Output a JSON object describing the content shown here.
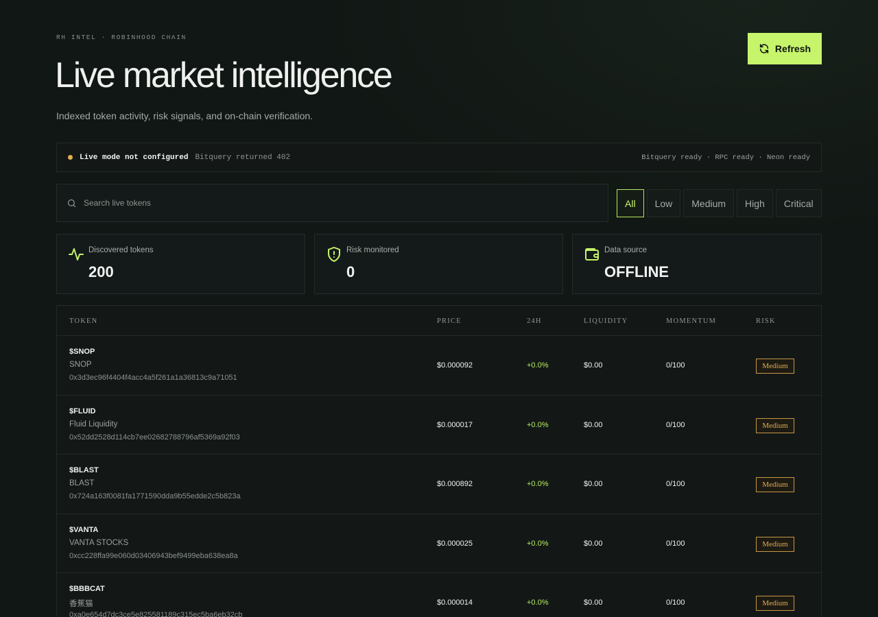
{
  "header": {
    "eyebrow": "RH INTEL · ROBINHOOD CHAIN",
    "title": "Live market intelligence",
    "subtitle": "Indexed token activity, risk signals, and on-chain verification.",
    "refresh_label": "Refresh",
    "refresh_icon": "refresh-icon"
  },
  "status": {
    "title": "Live mode not configured",
    "detail": "Bitquery returned 402",
    "services": "Bitquery ready · RPC ready · Neon ready",
    "dot_color": "#e1b14c"
  },
  "search": {
    "placeholder": "Search live tokens",
    "value": ""
  },
  "filters": [
    "All",
    "Low",
    "Medium",
    "High",
    "Critical"
  ],
  "active_filter": "All",
  "stats": [
    {
      "label": "Discovered tokens",
      "value": "200",
      "icon": "activity-icon"
    },
    {
      "label": "Risk monitored",
      "value": "0",
      "icon": "shield-alert-icon"
    },
    {
      "label": "Data source",
      "value": "OFFLINE",
      "icon": "wallet-icon"
    }
  ],
  "table": {
    "columns": [
      "TOKEN",
      "PRICE",
      "24H",
      "LIQUIDITY",
      "MOMENTUM",
      "RISK"
    ],
    "rows": [
      {
        "symbol": "$SNOP",
        "name": "SNOP",
        "address": "0x3d3ec96f4404f4acc4a5f261a1a36813c9a71051",
        "price": "$0.000092",
        "change": "+0.0%",
        "liquidity": "$0.00",
        "momentum": "0/100",
        "risk": "Medium"
      },
      {
        "symbol": "$FLUID",
        "name": "Fluid Liquidity",
        "address": "0x52dd2528d114cb7ee02682788796af5369a92f03",
        "price": "$0.000017",
        "change": "+0.0%",
        "liquidity": "$0.00",
        "momentum": "0/100",
        "risk": "Medium"
      },
      {
        "symbol": "$BLAST",
        "name": "BLAST",
        "address": "0x724a163f0081fa1771590dda9b55edde2c5b823a",
        "price": "$0.000892",
        "change": "+0.0%",
        "liquidity": "$0.00",
        "momentum": "0/100",
        "risk": "Medium"
      },
      {
        "symbol": "$VANTA",
        "name": "VANTA STOCKS",
        "address": "0xcc228ffa99e060d03406943bef9499eba638ea8a",
        "price": "$0.000025",
        "change": "+0.0%",
        "liquidity": "$0.00",
        "momentum": "0/100",
        "risk": "Medium"
      },
      {
        "symbol": "$BBBCAT",
        "name": "香蕉猫",
        "address": "0xa0e654d7dc3ce5e825581189c315ec5ba6eb32cb",
        "price": "$0.000014",
        "change": "+0.0%",
        "liquidity": "$0.00",
        "momentum": "0/100",
        "risk": "Medium"
      }
    ]
  },
  "colors": {
    "accent": "#c6f46b",
    "positive": "#b8ec64",
    "risk_medium": "#e1ae55",
    "background": "#111714"
  }
}
